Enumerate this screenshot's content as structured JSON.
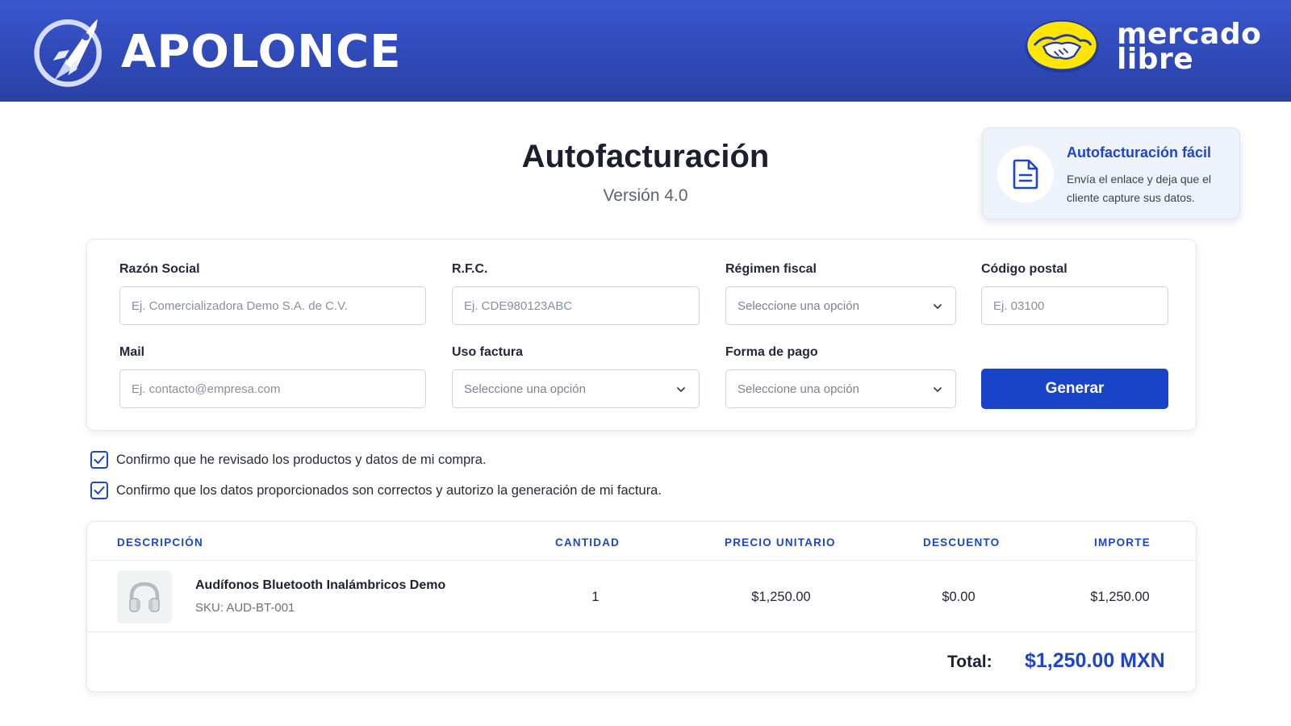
{
  "header": {
    "brand_name": "APOLONCE",
    "partner_name_line1": "mercado",
    "partner_name_line2": "libre",
    "logo_icon": "rocket-icon",
    "partner_icon": "handshake-icon",
    "background_color": "#2f49b8"
  },
  "page": {
    "title": "Autofacturación",
    "subtitle": "Versión 4.0"
  },
  "promo": {
    "icon": "document-icon",
    "title": "Autofacturación fácil",
    "text": "Envía el enlace y deja que el cliente capture sus datos."
  },
  "form": {
    "razon_social": {
      "label": "Razón Social",
      "placeholder": "Ej. Comercializadora Demo S.A. de C.V."
    },
    "rfc": {
      "label": "R.F.C.",
      "placeholder": "Ej. CDE980123ABC"
    },
    "regimen_fiscal": {
      "label": "Régimen fiscal",
      "value": "Seleccione una opción"
    },
    "codigo_postal": {
      "label": "Código postal",
      "placeholder": "Ej. 03100"
    },
    "mail": {
      "label": "Mail",
      "placeholder": "Ej. contacto@empresa.com"
    },
    "uso_factura": {
      "label": "Uso factura",
      "value": "Seleccione una opción"
    },
    "forma_pago": {
      "label": "Forma de pago",
      "value": "Seleccione una opción"
    },
    "generate_label": "Generar",
    "accent_color": "#1a44c7"
  },
  "confirmations": [
    {
      "label": "Confirmo que he revisado los productos y datos de mi compra.",
      "checked": true
    },
    {
      "label": "Confirmo que los datos proporcionados son correctos y autorizo la generación de mi factura.",
      "checked": true
    }
  ],
  "table": {
    "headers": {
      "descripcion": "DESCRIPCIÓN",
      "cantidad": "CANTIDAD",
      "precio": "PRECIO UNITARIO",
      "descuento": "DESCUENTO",
      "importe": "IMPORTE"
    },
    "rows": [
      {
        "thumbnail_icon": "headphones-icon",
        "name": "Audífonos Bluetooth Inalámbricos Demo",
        "sku": "SKU: AUD-BT-001",
        "cantidad": "1",
        "precio": "$1,250.00",
        "descuento": "$0.00",
        "importe": "$1,250.00"
      }
    ],
    "total_label": "Total:",
    "total_value": "$1,250.00 MXN"
  }
}
